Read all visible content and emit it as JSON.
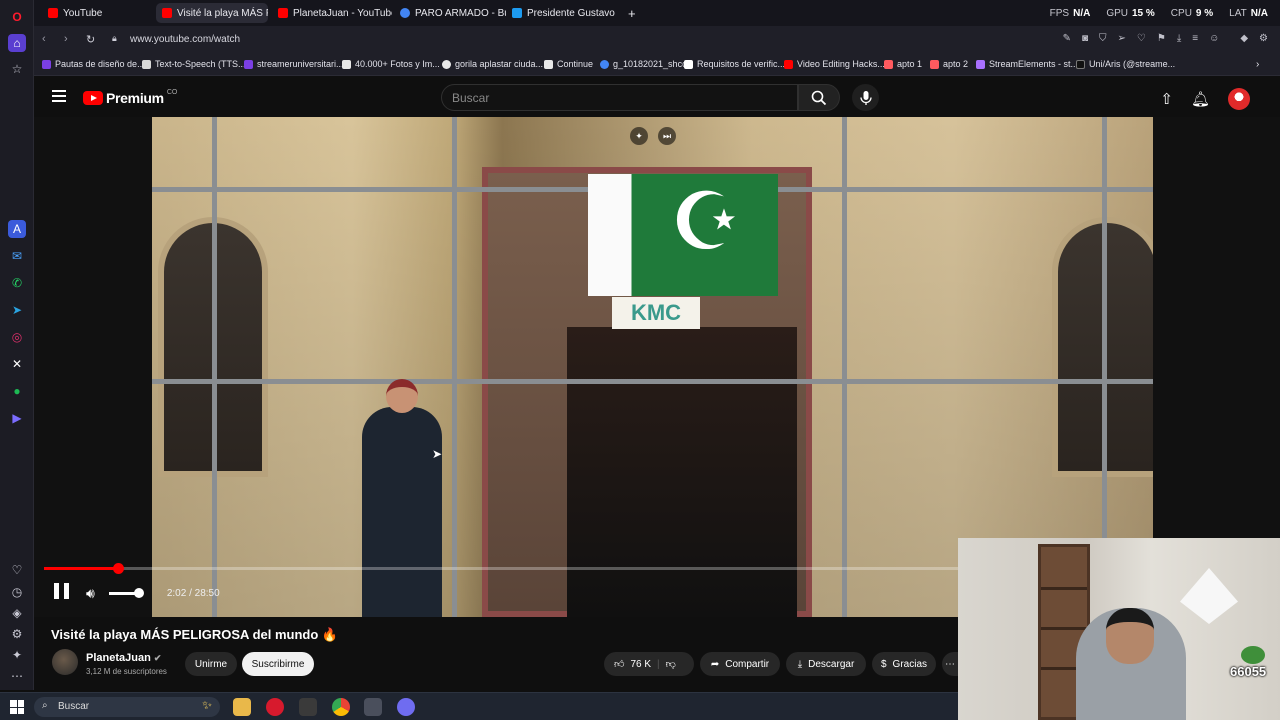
{
  "browser": {
    "tabs": [
      {
        "label": "YouTube",
        "color": "#ff0000"
      },
      {
        "label": "Visité la playa MÁS P...",
        "color": "#ff0000"
      },
      {
        "label": "PlanetaJuan - YouTube",
        "color": "#ff0000"
      },
      {
        "label": "PARO ARMADO - Buscar",
        "color": "#4285f4"
      },
      {
        "label": "Presidente Gustavo Petro",
        "color": "#1d9bf0"
      }
    ],
    "new_tab_icon": "plus-icon",
    "stats": [
      {
        "label": "FPS",
        "value": "N/A"
      },
      {
        "label": "GPU",
        "value": "15 %"
      },
      {
        "label": "CPU",
        "value": "9 %"
      },
      {
        "label": "LAT",
        "value": "N/A"
      }
    ],
    "url": "www.youtube.com/watch",
    "bookmarks": [
      {
        "label": "Pautas de diseño de...",
        "color": "#7b3fe4"
      },
      {
        "label": "Text-to-Speech (TTS...",
        "color": "#d9d9d9"
      },
      {
        "label": "streameruniversitari...",
        "color": "#7b3fe4"
      },
      {
        "label": "40.000+ Fotos y Im...",
        "color": "#e8e8e8"
      },
      {
        "label": "gorila aplastar ciuda...",
        "color": "#e8e8e8"
      },
      {
        "label": "Continue",
        "color": "#e8e8e8"
      },
      {
        "label": "g_10182021_shcc",
        "color": "#4285f4"
      },
      {
        "label": "Requisitos de verific...",
        "color": "#ffffff"
      },
      {
        "label": "Video Editing Hacks...",
        "color": "#ff0000"
      },
      {
        "label": "apto 1",
        "color": "#ff5a5f"
      },
      {
        "label": "apto 2",
        "color": "#ff5a5f"
      },
      {
        "label": "StreamElements - st...",
        "color": "#a970ff"
      },
      {
        "label": "Uni/Aris (@streame...",
        "color": "#111111"
      }
    ]
  },
  "youtube": {
    "logo_text": "Premium",
    "logo_sup": "CO",
    "search_placeholder": "Buscar",
    "video": {
      "current_time": "2:02",
      "duration": "28:50",
      "progress_fraction": 0.0705,
      "volume_fraction": 1.0,
      "time_label": "2:02 / 28:50",
      "sign_text": "KMC"
    },
    "title": "Visité la playa MÁS PELIGROSA del mundo 🔥",
    "channel": {
      "name": "PlanetaJuan",
      "verified_icon": "verified-check-icon",
      "subscribers": "3,12 M de suscriptores"
    },
    "buttons": {
      "join": "Unirme",
      "subscribe": "Suscribirme",
      "likes": "76 K",
      "share": "Compartir",
      "download": "Descargar",
      "thanks": "Gracias"
    }
  },
  "overlay": {
    "badge_number": "66055"
  },
  "taskbar": {
    "search_label": "Buscar"
  },
  "colors": {
    "yt_red": "#ff0000",
    "background": "#0f0f0f"
  }
}
